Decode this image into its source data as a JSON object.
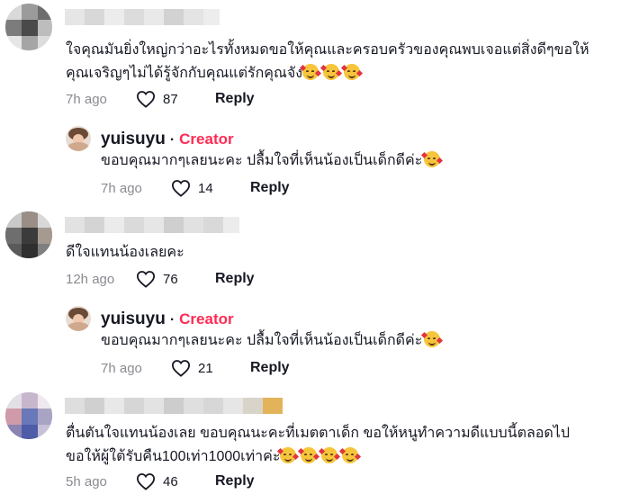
{
  "comments": [
    {
      "text_line1": "ใจคุณมันยิ่งใหญ่กว่าอะไรทั้งหมดขอให้คุณและครอบครัวของคุณพบเจอแต่สิ่งดีๆขอให้",
      "text_line2": "คุณเจริญๆไม่ได้รู้จักกับคุณแต่รักคุณจัง",
      "emoji": "smiling-face-with-hearts",
      "time": "7h ago",
      "likes": "87",
      "reply_label": "Reply"
    },
    {
      "text_line1": "ดีใจแทนน้องเลยคะ",
      "time": "12h ago",
      "likes": "76",
      "reply_label": "Reply"
    },
    {
      "text_line1": "ตื่นตันใจแทนน้องเลย ขอบคุณนะคะที่เมตตาเด็ก ขอให้หนูทำความดีแบบนี้ตลอดไป",
      "text_line2": "ขอให้ผู้ใต้รับคืน100เท่า1000เท่าค่ะ",
      "time": "5h ago",
      "likes": "46",
      "reply_label": "Reply"
    }
  ],
  "replies": [
    {
      "username": "yuisuyu",
      "separator": "·",
      "badge": "Creator",
      "text": "ขอบคุณมากๆเลยนะคะ ปลื้มใจที่เห็นน้องเป็นเด็กดีค่ะ",
      "time": "7h ago",
      "likes": "14",
      "reply_label": "Reply"
    },
    {
      "username": "yuisuyu",
      "separator": "·",
      "badge": "Creator",
      "text": "ขอบคุณมากๆเลยนะคะ ปลื้มใจที่เห็นน้องเป็นเด็กดีค่ะ",
      "time": "7h ago",
      "likes": "21",
      "reply_label": "Reply"
    }
  ],
  "colors": {
    "creator": "#fe2c55",
    "text": "#161823",
    "muted": "#8a8b91"
  },
  "icons": [
    "heart-outline-icon",
    "smiling-face-with-hearts-emoji"
  ]
}
